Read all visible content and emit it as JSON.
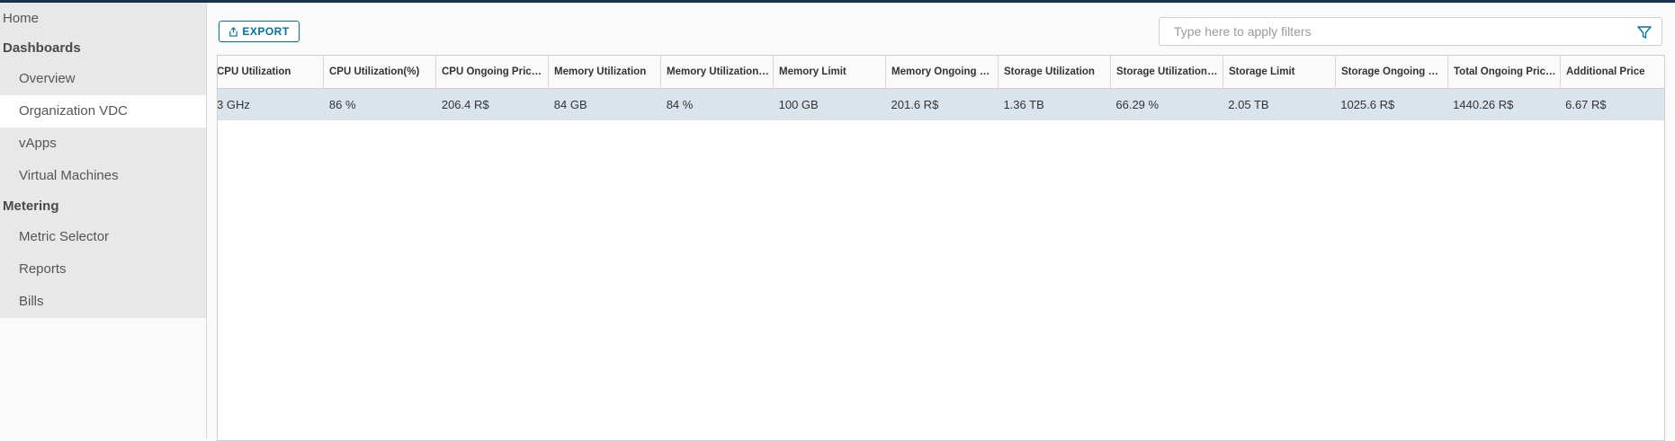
{
  "sidebar": {
    "home": "Home",
    "dashboards_header": "Dashboards",
    "overview": "Overview",
    "organization_vdc": "Organization VDC",
    "vapps": "vApps",
    "virtual_machines": "Virtual Machines",
    "metering_header": "Metering",
    "metric_selector": "Metric Selector",
    "reports": "Reports",
    "bills": "Bills"
  },
  "toolbar": {
    "export_label": "EXPORT",
    "filter_placeholder": "Type here to apply filters"
  },
  "table": {
    "columns": [
      "CPU Utilization",
      "CPU Utilization(%)",
      "CPU Ongoing Price ...",
      "Memory Utilization",
      "Memory Utilization(...",
      "Memory Limit",
      "Memory Ongoing Pr...",
      "Storage Utilization",
      "Storage Utilization(%)",
      "Storage Limit",
      "Storage Ongoing Pri...",
      "Total Ongoing Price...",
      "Additional Price"
    ],
    "rows": [
      [
        "3 GHz",
        "86 %",
        "206.4 R$",
        "84 GB",
        "84 %",
        "100 GB",
        "201.6 R$",
        "1.36 TB",
        "66.29 %",
        "2.05 TB",
        "1025.6 R$",
        "1440.26 R$",
        "6.67 R$"
      ]
    ]
  },
  "colors": {
    "accent": "#0072a3",
    "topbar": "#17324d",
    "row_selected": "#dbe4eb",
    "sidebar_panel": "#e8e8e8"
  }
}
